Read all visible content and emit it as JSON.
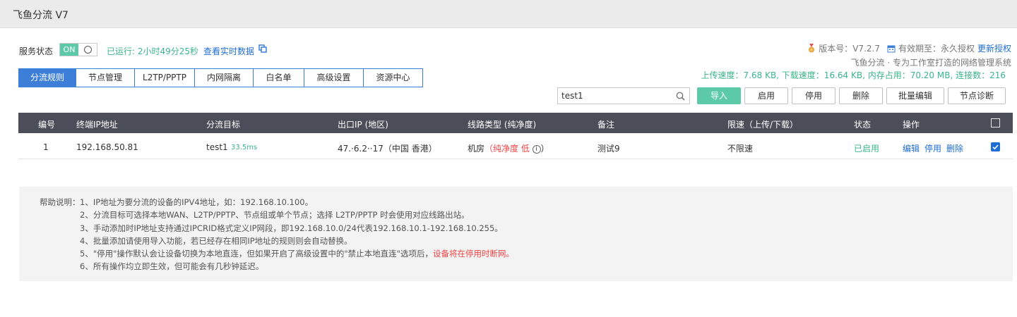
{
  "window": {
    "title": "飞鱼分流 V7"
  },
  "service": {
    "label": "服务状态",
    "toggle_on": "ON",
    "uptime": "已运行: 2小时49分25秒",
    "realtime_link": "查看实时数据"
  },
  "version": {
    "version_text": "版本号：V7.2.7",
    "expiry_text": "有效期至：永久授权",
    "update_link": "更新授权",
    "slogan": "飞鱼分流 · 专为工作室打造的网络管理系统",
    "stats": "上传速度：7.68 KB, 下载速度：16.64 KB, 内存占用：70.20 MB, 连接数：216"
  },
  "tabs": [
    {
      "label": "分流规则",
      "active": true
    },
    {
      "label": "节点管理",
      "active": false
    },
    {
      "label": "L2TP/PPTP",
      "active": false
    },
    {
      "label": "内网隔离",
      "active": false
    },
    {
      "label": "白名单",
      "active": false
    },
    {
      "label": "高级设置",
      "active": false
    },
    {
      "label": "资源中心",
      "active": false
    }
  ],
  "toolbar": {
    "search_value": "test1",
    "import_label": "导入",
    "enable_label": "启用",
    "disable_label": "停用",
    "delete_label": "删除",
    "batch_edit_label": "批量编辑",
    "diagnose_label": "节点诊断"
  },
  "table": {
    "headers": {
      "id": "编号",
      "ip": "终端IP地址",
      "target": "分流目标",
      "exit_ip": "出口IP (地区)",
      "line_type": "线路类型 (纯净度)",
      "note": "备注",
      "limit": "限速（上传/下载）",
      "status": "状态",
      "action": "操作"
    },
    "rows": [
      {
        "id": "1",
        "ip": "192.168.50.81",
        "target": "test1",
        "latency": "33.5ms",
        "exit_ip": "47.·6.2··17（中国 香港）",
        "line_type": "机房",
        "purity": "（纯净度 低",
        "purity_close": "）",
        "note": "测试9",
        "limit": "不限速",
        "status": "已启用",
        "edit": "编辑",
        "disable": "停用",
        "delete": "删除",
        "checked": true
      }
    ]
  },
  "help": {
    "prefix": "帮助说明：",
    "lines": [
      "1、IP地址为要分流的设备的IPV4地址，如：192.168.10.100。",
      "2、分流目标可选择本地WAN、L2TP/PPTP、节点组或单个节点；选择 L2TP/PPTP 时会使用对应线路出站。",
      "3、手动添加时IP地址支持通过IPCRID格式定义IP网段，即192.168.10.0/24代表192.168.10.1-192.168.10.255。",
      "4、批量添加请使用导入功能，若已经存在相同IP地址的规则则会自动替换。",
      "5、\"停用\"操作默认会让设备切换为本地直连，但如果开启了高级设置中的\"禁止本地直连\"选项后，",
      "6、所有操作均立即生效，但可能会有几秒钟延迟。"
    ],
    "line5_warning": "设备将在停用时断网。"
  },
  "colors": {
    "accent_green": "#5cc9a7",
    "accent_blue": "#3d7fd8",
    "header_dark": "#4b4d58",
    "warning_red": "#ee4444"
  }
}
